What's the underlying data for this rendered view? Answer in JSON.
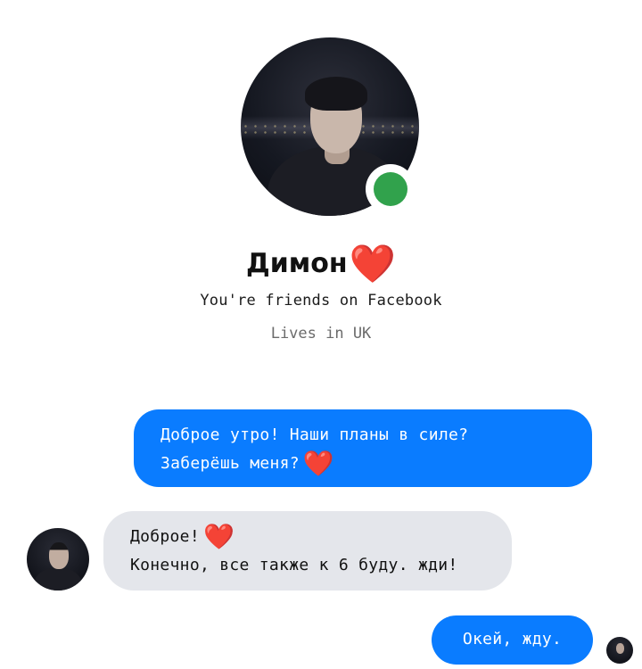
{
  "contact": {
    "name": "Димон",
    "name_emoji": "❤️",
    "friends_text": "You're friends on Facebook",
    "location_text": "Lives in UK",
    "online": true
  },
  "messages": [
    {
      "direction": "outgoing",
      "lines": [
        "Доброе утро! Наши планы в силе?",
        "Заберёшь меня?"
      ],
      "emoji": "❤️"
    },
    {
      "direction": "incoming",
      "lines": [
        "Доброе!",
        "Конечно, все также к 6 буду. жди!"
      ],
      "emoji": "❤️"
    },
    {
      "direction": "outgoing",
      "lines": [
        "Окей, жду."
      ]
    }
  ],
  "colors": {
    "outgoing_bubble": "#0a7cff",
    "incoming_bubble": "#e4e6eb",
    "online_dot": "#31a24c",
    "heart": "#f0513b"
  },
  "icons": {
    "heart": "heart-icon",
    "online": "online-status-icon"
  }
}
